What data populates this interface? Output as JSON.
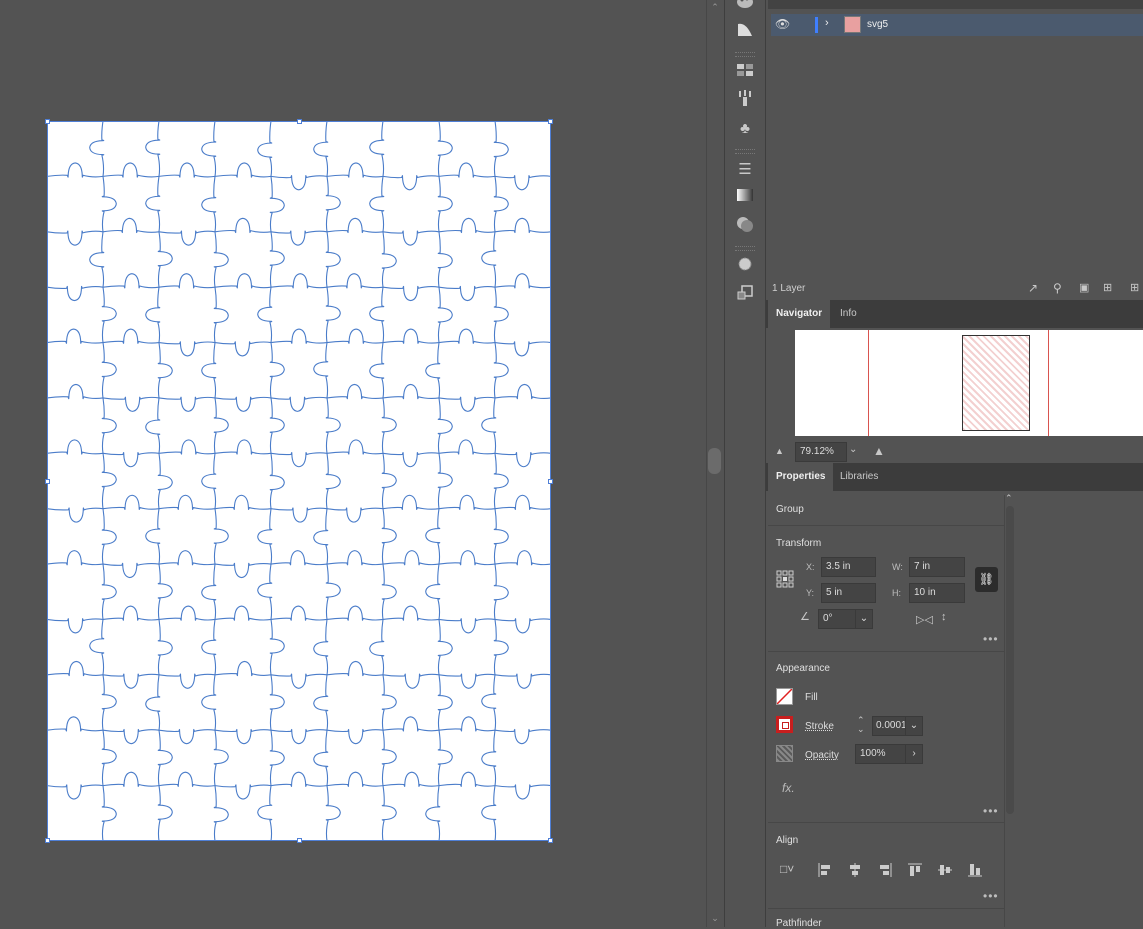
{
  "layers": {
    "layer_name": "svg5",
    "count_label": "1 Layer"
  },
  "navigator": {
    "tabs": [
      "Navigator",
      "Info"
    ],
    "zoom": "79.12%"
  },
  "properties": {
    "tabs": [
      "Properties",
      "Libraries"
    ],
    "selection_type": "Group",
    "transform": {
      "title": "Transform",
      "x_label": "X:",
      "x": "3.5 in",
      "y_label": "Y:",
      "y": "5 in",
      "w_label": "W:",
      "w": "7 in",
      "h_label": "H:",
      "h": "10 in",
      "angle": "0°"
    },
    "appearance": {
      "title": "Appearance",
      "fill_label": "Fill",
      "stroke_label": "Stroke",
      "stroke_value": "0.0001",
      "opacity_label": "Opacity",
      "opacity_value": "100%",
      "fx_label": "fx."
    },
    "align": {
      "title": "Align"
    },
    "pathfinder": {
      "title": "Pathfinder"
    }
  },
  "colors": {
    "puzzle_line": "#4a7cc9",
    "selection": "#4f7fd6",
    "layer_highlight": "#4b5a6e",
    "nav_frame": "#d9534f"
  },
  "puzzle": {
    "cols": 9,
    "rows": 13
  }
}
